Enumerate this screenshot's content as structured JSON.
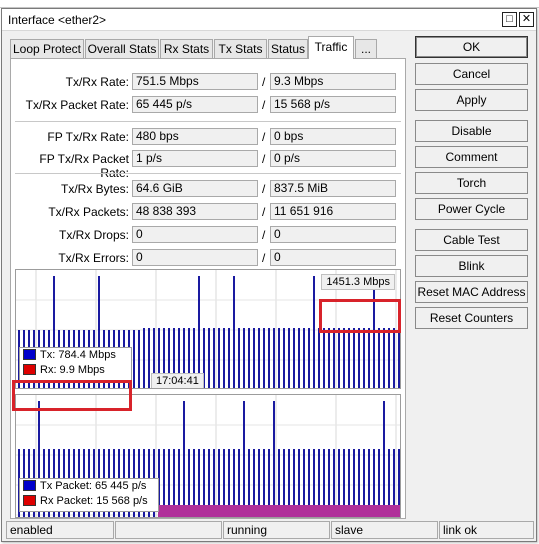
{
  "window": {
    "title": "Interface <ether2>"
  },
  "tabs": [
    {
      "label": "Loop Protect"
    },
    {
      "label": "Overall Stats"
    },
    {
      "label": "Rx Stats"
    },
    {
      "label": "Tx Stats"
    },
    {
      "label": "Status"
    },
    {
      "label": "Traffic",
      "active": true
    },
    {
      "label": "..."
    }
  ],
  "traffic": {
    "rate": {
      "label": "Tx/Rx Rate:",
      "tx": "751.5 Mbps",
      "rx": "9.3 Mbps"
    },
    "packet_rate": {
      "label": "Tx/Rx Packet Rate:",
      "tx": "65 445 p/s",
      "rx": "15 568 p/s"
    },
    "fp_rate": {
      "label": "FP Tx/Rx Rate:",
      "tx": "480 bps",
      "rx": "0 bps"
    },
    "fp_packet_rate": {
      "label": "FP Tx/Rx Packet Rate:",
      "tx": "1 p/s",
      "rx": "0 p/s"
    },
    "bytes": {
      "label": "Tx/Rx Bytes:",
      "tx": "64.6 GiB",
      "rx": "837.5 MiB"
    },
    "packets": {
      "label": "Tx/Rx Packets:",
      "tx": "48 838 393",
      "rx": "11 651 916"
    },
    "drops": {
      "label": "Tx/Rx Drops:",
      "tx": "0",
      "rx": "0"
    },
    "errors": {
      "label": "Tx/Rx Errors:",
      "tx": "0",
      "rx": "0"
    },
    "slash": "/"
  },
  "graph_bps": {
    "max_label": "1451.3 Mbps",
    "time_label": "17:04:41",
    "legend": [
      {
        "label": "Tx:  784.4 Mbps",
        "color": "#0000cc"
      },
      {
        "label": "Rx:  9.9 Mbps",
        "color": "#dd0000"
      }
    ]
  },
  "graph_pps": {
    "legend": [
      {
        "label": "Tx Packet:  65 445 p/s",
        "color": "#0000cc"
      },
      {
        "label": "Rx Packet:  15 568 p/s",
        "color": "#dd0000"
      }
    ]
  },
  "colors": {
    "tx": "#1a1aa0",
    "rx": "#b0309a",
    "highlight": "#d8232a"
  },
  "buttons": [
    {
      "label": "OK",
      "name": "ok-button"
    },
    {
      "label": "Cancel",
      "name": "cancel-button"
    },
    {
      "label": "Apply",
      "name": "apply-button"
    },
    {
      "label": "Disable",
      "name": "disable-button"
    },
    {
      "label": "Comment",
      "name": "comment-button"
    },
    {
      "label": "Torch",
      "name": "torch-button"
    },
    {
      "label": "Power Cycle",
      "name": "power-cycle-button"
    },
    {
      "label": "Cable Test",
      "name": "cable-test-button"
    },
    {
      "label": "Blink",
      "name": "blink-button"
    },
    {
      "label": "Reset MAC Address",
      "name": "reset-mac-address-button"
    },
    {
      "label": "Reset Counters",
      "name": "reset-counters-button"
    }
  ],
  "status": {
    "state": "enabled",
    "empty": "",
    "running": "running",
    "slave": "slave",
    "link": "link ok"
  }
}
